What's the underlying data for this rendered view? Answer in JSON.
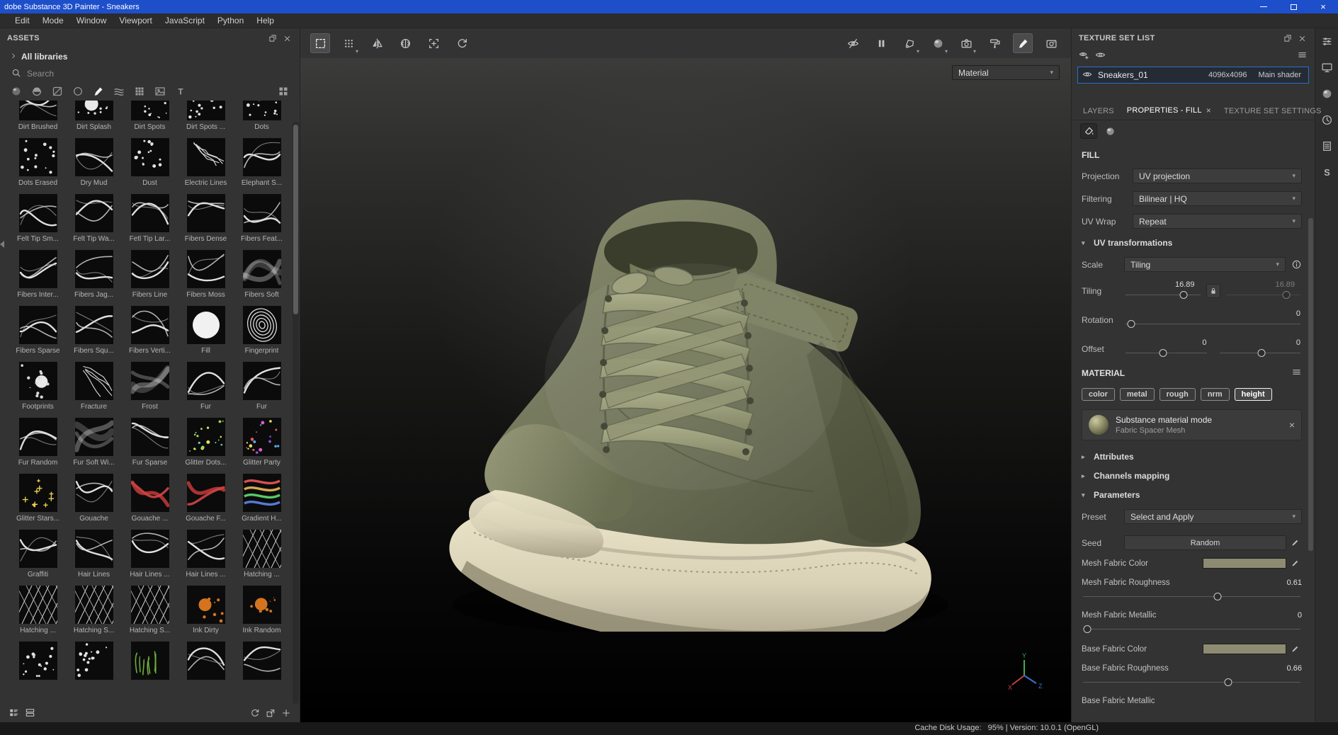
{
  "title_bar": {
    "title": "dobe Substance 3D Painter - Sneakers"
  },
  "menu_bar": {
    "items": [
      "Edit",
      "Mode",
      "Window",
      "Viewport",
      "JavaScript",
      "Python",
      "Help"
    ]
  },
  "assets_panel": {
    "title": "ASSETS",
    "library_label": "All libraries",
    "search_placeholder": "Search",
    "filter_icons": [
      {
        "name": "materials-filter-icon",
        "glyph": "sphereDark"
      },
      {
        "name": "smart-materials-filter-icon",
        "glyph": "halfsphere"
      },
      {
        "name": "smart-masks-filter-icon",
        "glyph": "masksq"
      },
      {
        "name": "filters-filter-icon",
        "glyph": "circle"
      },
      {
        "name": "brushes-filter-icon",
        "glyph": "brush",
        "active": true
      },
      {
        "name": "alphas-filter-icon",
        "glyph": "weave"
      },
      {
        "name": "textures-filter-icon",
        "glyph": "grid9"
      },
      {
        "name": "environments-filter-icon",
        "glyph": "image"
      },
      {
        "name": "fonts-filter-icon",
        "glyph": "textT"
      }
    ],
    "view_options_icon": "biggrid",
    "assets": [
      {
        "label": "Dirt Brushed",
        "tint": "line"
      },
      {
        "label": "Dirt Splash",
        "tint": "splat"
      },
      {
        "label": "Dirt Spots",
        "tint": "dots"
      },
      {
        "label": "Dirt Spots ...",
        "tint": "dots"
      },
      {
        "label": "Dots",
        "tint": "dots"
      },
      {
        "label": "Dots Erased",
        "tint": "dots"
      },
      {
        "label": "Dry Mud",
        "tint": "line"
      },
      {
        "label": "Dust",
        "tint": "dots"
      },
      {
        "label": "Electric Lines",
        "tint": "crack"
      },
      {
        "label": "Elephant S...",
        "tint": "line"
      },
      {
        "label": "Felt Tip Sm...",
        "tint": "line"
      },
      {
        "label": "Felt Tip Wa...",
        "tint": "line"
      },
      {
        "label": "Fetl Tip Lar...",
        "tint": "line"
      },
      {
        "label": "Fibers Dense",
        "tint": "line"
      },
      {
        "label": "Fibers Feat...",
        "tint": "line"
      },
      {
        "label": "Fibers Inter...",
        "tint": "line"
      },
      {
        "label": "Fibers Jag...",
        "tint": "line"
      },
      {
        "label": "Fibers Line",
        "tint": "line"
      },
      {
        "label": "Fibers Moss",
        "tint": "line"
      },
      {
        "label": "Fibers Soft",
        "tint": "soft"
      },
      {
        "label": "Fibers Sparse",
        "tint": "line"
      },
      {
        "label": "Fibers Squ...",
        "tint": "line"
      },
      {
        "label": "Fibers Verti...",
        "tint": "line"
      },
      {
        "label": "Fill",
        "tint": "fill"
      },
      {
        "label": "Fingerprint",
        "tint": "print"
      },
      {
        "label": "Footprints",
        "tint": "splat"
      },
      {
        "label": "Fracture",
        "tint": "crack"
      },
      {
        "label": "Frost",
        "tint": "soft"
      },
      {
        "label": "Fur",
        "tint": "line"
      },
      {
        "label": "Fur",
        "tint": "line"
      },
      {
        "label": "Fur Random",
        "tint": "line"
      },
      {
        "label": "Fur Soft Wi...",
        "tint": "soft"
      },
      {
        "label": "Fur Sparse",
        "tint": "line"
      },
      {
        "label": "Glitter Dots...",
        "tint": "glitterG"
      },
      {
        "label": "Glitter Party",
        "tint": "glitterP"
      },
      {
        "label": "Glitter Stars...",
        "tint": "stars"
      },
      {
        "label": "Gouache",
        "tint": "line"
      },
      {
        "label": "Gouache ...",
        "tint": "red"
      },
      {
        "label": "Gouache F...",
        "tint": "red"
      },
      {
        "label": "Gradient H...",
        "tint": "rainbow"
      },
      {
        "label": "Graffiti",
        "tint": "line"
      },
      {
        "label": "Hair Lines",
        "tint": "line"
      },
      {
        "label": "Hair Lines ...",
        "tint": "line"
      },
      {
        "label": "Hair Lines ...",
        "tint": "line"
      },
      {
        "label": "Hatching ...",
        "tint": "hatch"
      },
      {
        "label": "Hatching ...",
        "tint": "hatch"
      },
      {
        "label": "Hatching S...",
        "tint": "hatch"
      },
      {
        "label": "Hatching S...",
        "tint": "hatch"
      },
      {
        "label": "Ink Dirty",
        "tint": "ink"
      },
      {
        "label": "Ink Random",
        "tint": "ink"
      },
      {
        "label": "",
        "tint": "dots"
      },
      {
        "label": "",
        "tint": "dots"
      },
      {
        "label": "",
        "tint": "plant"
      },
      {
        "label": "",
        "tint": "line"
      },
      {
        "label": "",
        "tint": "line"
      }
    ]
  },
  "viewport_toolbar": {
    "left": [
      {
        "name": "marquee-select-icon",
        "glyph": "selframe",
        "active": true
      },
      {
        "name": "stencil-grid-icon",
        "glyph": "dotgrid",
        "caret": true
      },
      {
        "name": "symmetry-icon",
        "glyph": "mirror"
      },
      {
        "name": "radial-symmetry-icon",
        "glyph": "mirror2"
      },
      {
        "name": "frame-add-icon",
        "glyph": "frameplus"
      },
      {
        "name": "reset-camera-icon",
        "glyph": "orbit"
      }
    ],
    "right": [
      {
        "name": "hide-overlays-icon",
        "glyph": "eyeoff"
      },
      {
        "name": "pause-engine-icon",
        "glyph": "pause"
      },
      {
        "name": "selection-mask-icon",
        "glyph": "lasso",
        "caret": true
      },
      {
        "name": "render-mode-icon",
        "glyph": "sphere",
        "caret": true
      },
      {
        "name": "camera-views-icon",
        "glyph": "camera",
        "caret": true
      },
      {
        "name": "projection-tool-icon",
        "glyph": "roller"
      },
      {
        "name": "paint-brush-icon",
        "glyph": "brush",
        "active": true
      },
      {
        "name": "screenshot-icon",
        "glyph": "capture"
      }
    ]
  },
  "viewport": {
    "shading_mode": "Material"
  },
  "texture_panel": {
    "title": "TEXTURE SET LIST",
    "set": {
      "name": "Sneakers_01",
      "resolution": "4096x4096",
      "shader": "Main shader"
    },
    "tabs": [
      {
        "label": "LAYERS"
      },
      {
        "label": "PROPERTIES - FILL",
        "active": true,
        "closable": true
      },
      {
        "label": "TEXTURE SET SETTINGS"
      }
    ],
    "prop_mode_icons": [
      {
        "name": "fill-properties-icon",
        "glyph": "bucket",
        "active": true
      },
      {
        "name": "material-properties-icon",
        "glyph": "sphere"
      }
    ],
    "fill": {
      "header": "FILL",
      "projection_label": "Projection",
      "projection_value": "UV projection",
      "filtering_label": "Filtering",
      "filtering_value": "Bilinear | HQ",
      "uv_wrap_label": "UV Wrap",
      "uv_wrap_value": "Repeat",
      "uv_transform_header": "UV transformations",
      "scale_label": "Scale",
      "scale_value": "Tiling",
      "tiling_label": "Tiling",
      "tiling_value": "16.89",
      "tiling_linked_value": "16.89",
      "tiling_pos": 0.75,
      "tiling_linked_pos": 0.78,
      "rotation_label": "Rotation",
      "rotation_value": "0",
      "rotation_pos": 0.03,
      "offset_label": "Offset",
      "offset_value_1": "0",
      "offset_value_2": "0",
      "offset_pos_1": 0.45,
      "offset_pos_2": 0.5
    },
    "material": {
      "header": "MATERIAL",
      "channels": [
        {
          "label": "color"
        },
        {
          "label": "metal"
        },
        {
          "label": "rough"
        },
        {
          "label": "nrm"
        },
        {
          "label": "height",
          "active": true
        }
      ],
      "mode_title": "Substance material mode",
      "mode_subtitle": "Fabric Spacer Mesh",
      "attributes_header": "Attributes",
      "channels_mapping_header": "Channels mapping",
      "parameters_header": "Parameters",
      "preset_label": "Preset",
      "preset_value": "Select and Apply",
      "seed_label": "Seed",
      "seed_value": "Random",
      "swatch_color": "#8d8c72",
      "params": [
        {
          "label": "Mesh Fabric Color",
          "type": "color"
        },
        {
          "label": "Mesh Fabric Roughness",
          "type": "slider",
          "value": "0.61",
          "pos": 0.61
        },
        {
          "label": "Mesh Fabric Metallic",
          "type": "slider",
          "value": "0",
          "pos": 0.02
        },
        {
          "label": "Base Fabric Color",
          "type": "color"
        },
        {
          "label": "Base Fabric Roughness",
          "type": "slider",
          "value": "0.66",
          "pos": 0.66
        },
        {
          "label": "Base Fabric Metallic",
          "type": "slider",
          "partial": true,
          "pos": 0.02
        }
      ]
    }
  },
  "right_strip": [
    {
      "name": "settings-icon",
      "glyph": "sliders"
    },
    {
      "name": "display-settings-icon",
      "glyph": "monitor"
    },
    {
      "name": "shader-settings-icon",
      "glyph": "sphere"
    },
    {
      "name": "history-icon",
      "glyph": "clock"
    },
    {
      "name": "log-icon",
      "glyph": "doc"
    },
    {
      "name": "substance-logo",
      "glyph": "slogo"
    }
  ],
  "status_bar": {
    "text": "Cache Disk Usage:   95% | Version: 10.0.1 (OpenGL)"
  }
}
